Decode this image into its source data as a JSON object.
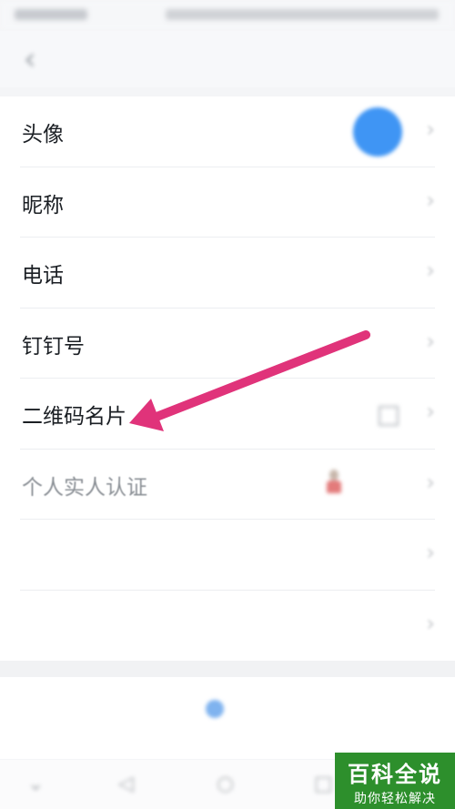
{
  "status_bar": {
    "left_text": "",
    "right_text": ""
  },
  "header": {
    "title": "",
    "right_action": ""
  },
  "profile_rows": [
    {
      "label": "头像",
      "value": ""
    },
    {
      "label": "昵称",
      "value": ""
    },
    {
      "label": "电话",
      "value": ""
    },
    {
      "label": "钉钉号",
      "value": ""
    },
    {
      "label": "二维码名片",
      "value": ""
    },
    {
      "label": "个人实人认证",
      "value": ""
    },
    {
      "label": "",
      "value": ""
    },
    {
      "label": "",
      "value": ""
    }
  ],
  "company": {
    "title": "",
    "right_text": "",
    "description": ""
  },
  "watermark": {
    "brand": "百科全说",
    "slogan": "助你轻松解决"
  },
  "colors": {
    "arrow": "#e0337a",
    "avatar": "#3f95f4",
    "watermark_bg": "#2d8f2c"
  }
}
